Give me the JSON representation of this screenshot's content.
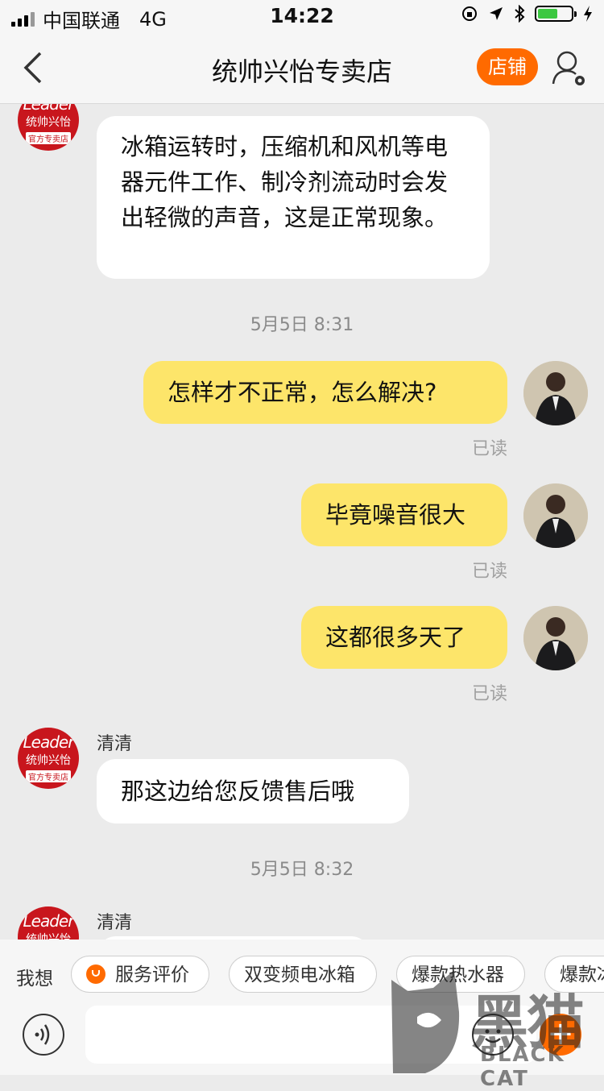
{
  "status_bar": {
    "carrier": "中国联通",
    "network": "4G",
    "time": "14:22",
    "battery_percent": 0.6
  },
  "header": {
    "title": "统帅兴怡专卖店",
    "shop_button": "店铺"
  },
  "shop_avatar": {
    "logo": "Leader",
    "name": "统帅兴怡",
    "tag": "官方专卖店"
  },
  "messages": [
    {
      "type": "received",
      "text": "冰箱运转时，压缩机和风机等电器元件工作、制冷剂流动时会发出轻微的声音，这是正常现象。"
    },
    {
      "type": "time",
      "text": "5月5日 8:31"
    },
    {
      "type": "sent",
      "text": "怎样才不正常，怎么解决?",
      "status": "已读"
    },
    {
      "type": "sent",
      "text": "毕竟噪音很大",
      "status": "已读"
    },
    {
      "type": "sent",
      "text": "这都很多天了",
      "status": "已读"
    },
    {
      "type": "received",
      "sender": "清清",
      "text": "那这边给您反馈售后哦"
    },
    {
      "type": "time",
      "text": "5月5日 8:32"
    },
    {
      "type": "received",
      "sender": "清清",
      "text": ""
    }
  ],
  "quick_bar": {
    "label": "我想",
    "chips": [
      "服务评价",
      "双变频电冰箱",
      "爆款热水器",
      "爆款冰"
    ]
  },
  "input_bar": {
    "placeholder": ""
  },
  "watermark": {
    "cn": "黑猫",
    "en": "BLACK CAT"
  }
}
